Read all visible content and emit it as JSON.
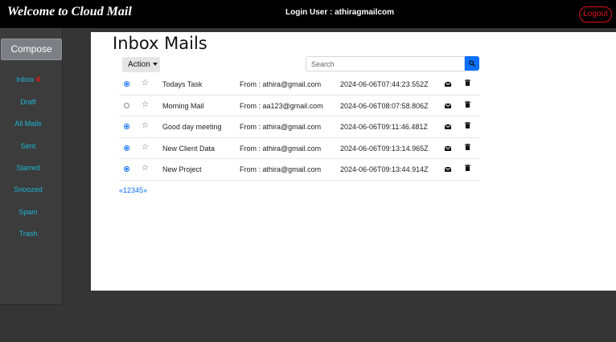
{
  "header": {
    "brand": "Welcome to Cloud Mail",
    "login_user": "Login User : athiragmailcom",
    "logout_label": "Logout"
  },
  "sidebar": {
    "compose_label": "Compose",
    "items": [
      {
        "label": "Inbox",
        "count": "4"
      },
      {
        "label": "Draft"
      },
      {
        "label": "All Mails"
      },
      {
        "label": "Sent"
      },
      {
        "label": "Starred"
      },
      {
        "label": "Snoozed"
      },
      {
        "label": "Spam"
      },
      {
        "label": "Trash"
      }
    ]
  },
  "main": {
    "title": "Inbox Mails",
    "action_label": "Action",
    "search_placeholder": "Search"
  },
  "mails": [
    {
      "selected": true,
      "subject": "Todays Task",
      "from": "From : athira@gmail.com",
      "date": "2024-06-06T07:44:23.552Z"
    },
    {
      "selected": false,
      "subject": "Morning Mail",
      "from": "From : aa123@gmail.com",
      "date": "2024-06-06T08:07:58.806Z"
    },
    {
      "selected": true,
      "subject": "Good day meeting",
      "from": "From : athira@gmail.com",
      "date": "2024-06-06T09:11:46.481Z"
    },
    {
      "selected": true,
      "subject": "New Client Data",
      "from": "From : athira@gmail.com",
      "date": "2024-06-06T09:13:14.965Z"
    },
    {
      "selected": true,
      "subject": "New Project",
      "from": "From : athira@gmail.com",
      "date": "2024-06-06T09:13:44.914Z"
    }
  ],
  "pagination": {
    "prev": "«",
    "pages": [
      "1",
      "2",
      "3",
      "4",
      "5"
    ],
    "next": "»"
  },
  "colors": {
    "accent": "#0b6efd",
    "nav_link": "#1db5d4",
    "logout": "#e0101a",
    "badge": "#e01818"
  },
  "icons": {
    "star": "star-outline-icon",
    "mail": "envelope-icon",
    "delete": "trash-icon",
    "search": "search-icon"
  }
}
